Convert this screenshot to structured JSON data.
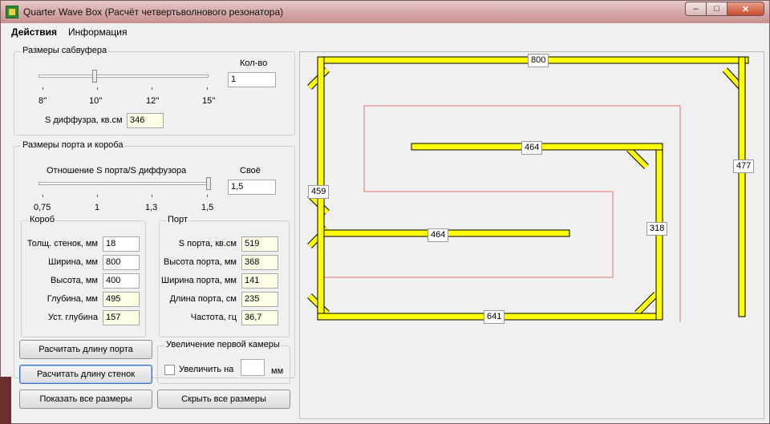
{
  "window": {
    "title": "Quarter Wave Box (Расчёт четвертьволнового резонатора)",
    "controls": {
      "minimize": "–",
      "maximize": "□",
      "close": "✕"
    }
  },
  "menu": [
    "Действия",
    "Информация"
  ],
  "subwoofer": {
    "legend": "Размеры сабвуфера",
    "count_label": "Кол-во",
    "count_value": "1",
    "ticks": [
      "8''",
      "10''",
      "12''",
      "15''"
    ],
    "slider_value_fraction": 0.33,
    "s_diffuser_label": "S диффузра, кв.см",
    "s_diffuser_value": "346"
  },
  "port_box": {
    "legend": "Размеры порта и короба",
    "ratio_label": "Отношение S порта/S диффузора",
    "custom_label": "Своё",
    "custom_value": "1,5",
    "ticks": [
      "0,75",
      "1",
      "1,3",
      "1,5"
    ],
    "slider_value_fraction": 1.0
  },
  "box": {
    "legend": "Короб",
    "fields": [
      {
        "label": "Толщ. стенок, мм",
        "value": "18"
      },
      {
        "label": "Ширина, мм",
        "value": "800"
      },
      {
        "label": "Высота, мм",
        "value": "400"
      },
      {
        "label": "Глубина, мм",
        "value": "495"
      },
      {
        "label": "Уст. глубина",
        "value": "157"
      }
    ]
  },
  "port": {
    "legend": "Порт",
    "fields": [
      {
        "label": "S порта, кв.см",
        "value": "519"
      },
      {
        "label": "Высота порта, мм",
        "value": "368"
      },
      {
        "label": "Ширина порта, мм",
        "value": "141"
      },
      {
        "label": "Длина порта, см",
        "value": "235"
      },
      {
        "label": "Частота, гц",
        "value": "36,7"
      }
    ]
  },
  "buttons": {
    "calc_port": "Расчитать длину порта",
    "calc_walls": "Расчитать длину стенок",
    "show_all": "Показать все размеры",
    "hide_all": "Скрыть все размеры"
  },
  "first_chamber": {
    "legend": "Увеличение первой камеры",
    "checkbox_label": "Увеличить на",
    "value": "",
    "unit": "мм"
  },
  "drawing": {
    "colors": {
      "wall": "#ffff00",
      "outline": "#000000",
      "path": "#e07070"
    },
    "dimensions": [
      "800",
      "464",
      "477",
      "459",
      "318",
      "464",
      "641"
    ]
  }
}
